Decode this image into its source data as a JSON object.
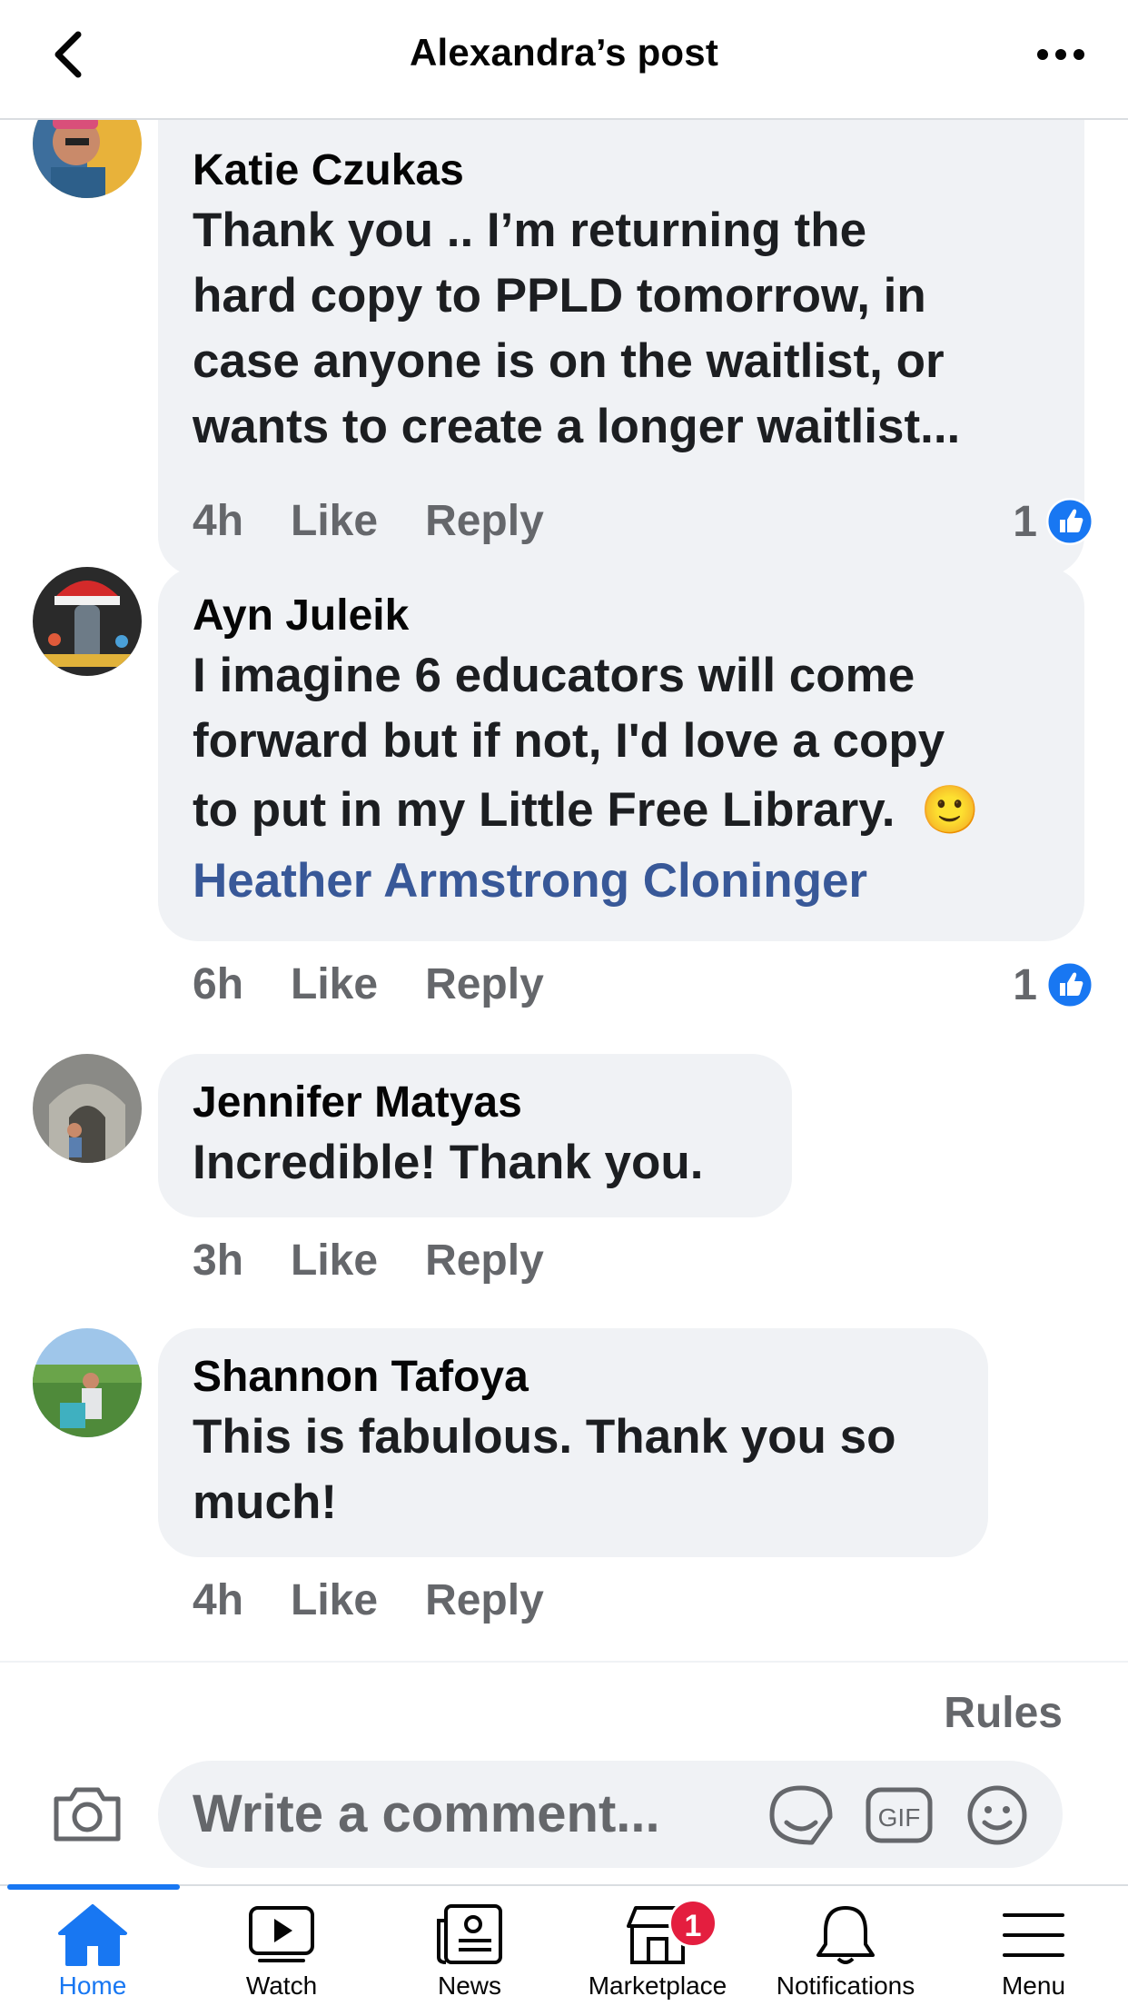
{
  "header": {
    "title": "Alexandra’s post",
    "back_icon": "chevron-left-icon",
    "more_icon": "more-horizontal-icon"
  },
  "comments": [
    {
      "author": "Katie Czukas",
      "lines": [
        "Thank you .. I’m returning the",
        "hard copy to PPLD tomorrow, in",
        "case anyone is on the waitlist, or",
        "wants to create a longer waitlist..."
      ],
      "time": "4h",
      "like_label": "Like",
      "reply_label": "Reply",
      "reaction_count": "1"
    },
    {
      "author": "Ayn Juleik",
      "lines": [
        "I imagine 6 educators will come",
        "forward but if not, I'd love a copy",
        "to put in my Little Free Library."
      ],
      "emoji": "🙂",
      "mention": "Heather Armstrong Cloninger",
      "time": "6h",
      "like_label": "Like",
      "reply_label": "Reply",
      "reaction_count": "1"
    },
    {
      "author": "Jennifer Matyas",
      "lines": [
        "Incredible! Thank you."
      ],
      "time": "3h",
      "like_label": "Like",
      "reply_label": "Reply"
    },
    {
      "author": "Shannon Tafoya",
      "lines": [
        "This is fabulous. Thank you so",
        "much!"
      ],
      "time": "4h",
      "like_label": "Like",
      "reply_label": "Reply"
    }
  ],
  "rules_label": "Rules",
  "composer": {
    "placeholder": "Write a comment...",
    "icons": [
      "camera-icon",
      "sticker-icon",
      "gif-icon",
      "emoji-icon"
    ]
  },
  "tabbar": {
    "items": [
      {
        "label": "Home",
        "icon": "home-icon",
        "active": true
      },
      {
        "label": "Watch",
        "icon": "watch-icon"
      },
      {
        "label": "News",
        "icon": "news-icon"
      },
      {
        "label": "Marketplace",
        "icon": "marketplace-icon",
        "badge": "1"
      },
      {
        "label": "Notifications",
        "icon": "bell-icon"
      },
      {
        "label": "Menu",
        "icon": "menu-icon"
      }
    ]
  },
  "colors": {
    "accent": "#1877f2",
    "mention": "#385898",
    "bubble": "#f0f2f5",
    "muted": "#65676b",
    "badge": "#e41e3f"
  }
}
